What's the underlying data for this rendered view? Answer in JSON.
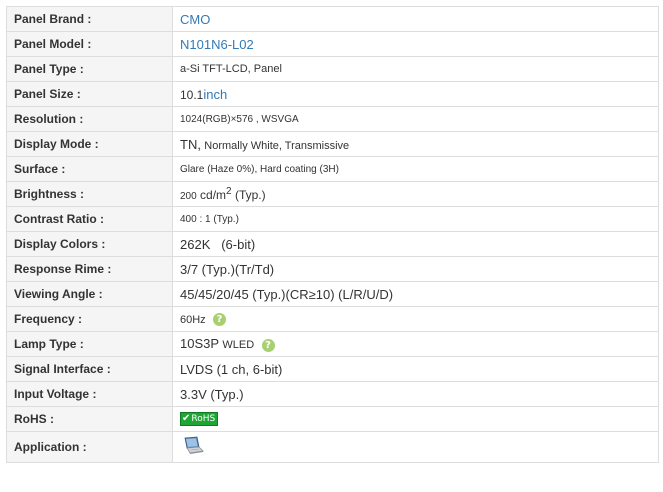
{
  "specs": {
    "panel_brand": {
      "label": "Panel Brand :",
      "value": "CMO"
    },
    "panel_model": {
      "label": "Panel Model :",
      "value": "N101N6-L02"
    },
    "panel_type": {
      "label": "Panel Type :",
      "value": "a-Si TFT-LCD, Panel"
    },
    "panel_size": {
      "label": "Panel Size :",
      "value": "10.1",
      "unit": "inch"
    },
    "resolution": {
      "label": "Resolution :",
      "value": "1024(RGB)×576 , WSVGA"
    },
    "display_mode": {
      "label": "Display Mode :",
      "value_main": "TN,",
      "value_rest": "Normally White, Transmissive"
    },
    "surface": {
      "label": "Surface :",
      "value": "Glare (Haze 0%), Hard coating (3H)"
    },
    "brightness": {
      "label": "Brightness :",
      "value_num": "200",
      "value_unit": "cd/m",
      "superscript": "2",
      "value_rest": "(Typ.)"
    },
    "contrast_ratio": {
      "label": "Contrast Ratio :",
      "value": "400 : 1 (Typ.)"
    },
    "display_colors": {
      "label": "Display Colors :",
      "value": "262K   (6-bit)"
    },
    "response_time": {
      "label": "Response Rime :",
      "value": "3/7 (Typ.)(Tr/Td)"
    },
    "viewing_angle": {
      "label": "Viewing Angle :",
      "value": "45/45/20/45 (Typ.)(CR≥10) (L/R/U/D)"
    },
    "frequency": {
      "label": "Frequency :",
      "value": "60Hz",
      "help_glyph": "?"
    },
    "lamp_type": {
      "label": "Lamp Type :",
      "value_main": "10S3P",
      "value_rest": "WLED",
      "help_glyph": "?"
    },
    "signal_interface": {
      "label": "Signal Interface :",
      "value": "LVDS (1 ch, 6-bit)"
    },
    "input_voltage": {
      "label": "Input Voltage :",
      "value": "3.3V (Typ.)"
    },
    "rohs": {
      "label": "RoHS :",
      "badge_text": "RoHS",
      "badge_check": "✔"
    },
    "application": {
      "label": "Application :",
      "icon": "laptop-icon"
    }
  },
  "colors": {
    "label_bg": "#f5f5f5",
    "border": "#dddddd",
    "link": "#337ab7",
    "help_icon": "#a8cf72",
    "rohs_badge": "#1ea634"
  }
}
